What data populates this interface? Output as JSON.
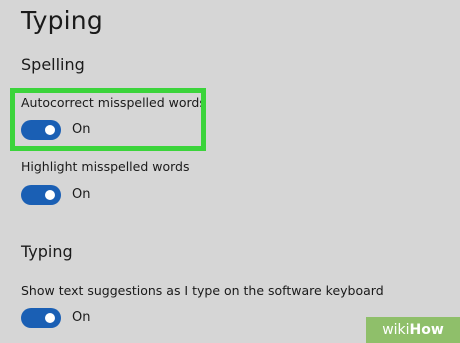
{
  "page": {
    "title": "Typing"
  },
  "sections": {
    "spelling": {
      "heading": "Spelling",
      "settings": [
        {
          "label": "Autocorrect misspelled words",
          "state": "On"
        },
        {
          "label": "Highlight misspelled words",
          "state": "On"
        }
      ]
    },
    "typing": {
      "heading": "Typing",
      "settings": [
        {
          "label": "Show text suggestions as I type on the software keyboard",
          "state": "On"
        }
      ]
    }
  },
  "watermark": {
    "part1": "wiki",
    "part2": "How"
  },
  "colors": {
    "background": "#d6d6d6",
    "toggle_on": "#1a5fb4",
    "highlight": "#3bd43b"
  }
}
